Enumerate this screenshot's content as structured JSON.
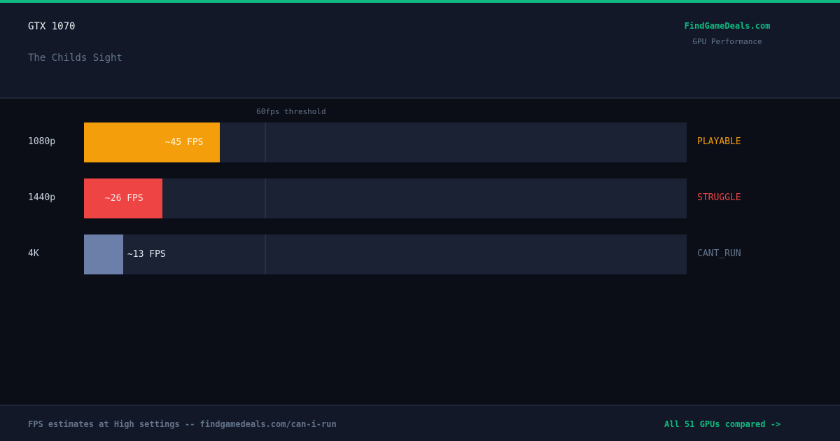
{
  "header": {
    "gpu_name": "GTX 1070",
    "game_title": "The Childs Sight",
    "brand": "FindGameDeals.com",
    "brand_subtitle": "GPU Performance"
  },
  "chart_data": {
    "type": "bar",
    "orientation": "horizontal",
    "categories": [
      "1080p",
      "1440p",
      "4K"
    ],
    "values": [
      45,
      26,
      13
    ],
    "value_labels": [
      "~45 FPS",
      "~26 FPS",
      "~13 FPS"
    ],
    "statuses": [
      "PLAYABLE",
      "STRUGGLE",
      "CANT_RUN"
    ],
    "colors": [
      "#f59e0b",
      "#ef4444",
      "#6b7fa8"
    ],
    "status_colors": [
      "#f59e0b",
      "#ef4444",
      "#64748b"
    ],
    "xlim": [
      0,
      200
    ],
    "threshold": {
      "value": 60,
      "label": "60fps threshold"
    }
  },
  "footer": {
    "note": "FPS estimates at High settings -- findgamedeals.com/can-i-run",
    "link": "All 51 GPUs compared ->"
  },
  "colors": {
    "accent": "#10b981",
    "background": "#0b0e17",
    "panel": "#121827",
    "track": "#1b2234"
  }
}
